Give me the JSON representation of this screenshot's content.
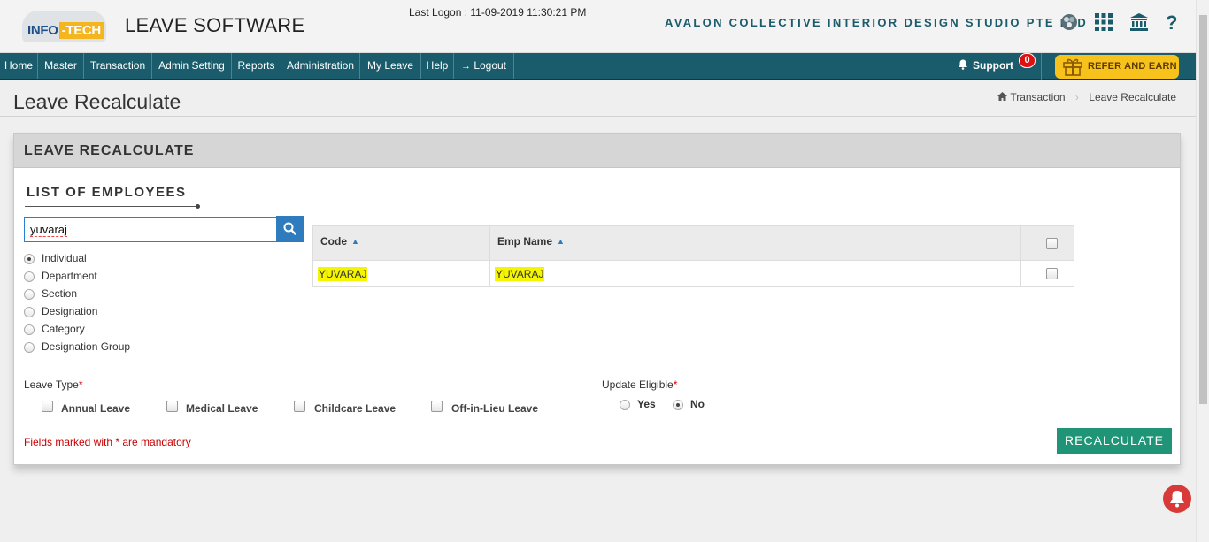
{
  "header": {
    "logo_part1": "INFO",
    "logo_part2": "-TECH",
    "app_name": "LEAVE SOFTWARE",
    "last_logon": "Last Logon : 11-09-2019 11:30:21 PM",
    "company": "AVALON COLLECTIVE INTERIOR DESIGN STUDIO PTE LTD",
    "icons": [
      "palette-icon",
      "apps-grid-icon",
      "bank-icon",
      "help-icon"
    ]
  },
  "nav": {
    "items": [
      "Home",
      "Master",
      "Transaction",
      "Admin Setting",
      "Reports",
      "Administration",
      "My Leave",
      "Help",
      "Logout"
    ],
    "support_label": "Support",
    "support_count": "0",
    "refer_label": "REFER AND EARN"
  },
  "page": {
    "title": "Leave Recalculate",
    "breadcrumb": [
      "Transaction",
      "Leave Recalculate"
    ]
  },
  "panel": {
    "heading": "LEAVE RECALCULATE",
    "employees_title": "LIST OF EMPLOYEES",
    "search_value": "yuvaraj",
    "filter_options": [
      "Individual",
      "Department",
      "Section",
      "Designation",
      "Category",
      "Designation Group"
    ],
    "selected_filter": "Individual",
    "table": {
      "columns": [
        "Code",
        "Emp Name"
      ],
      "rows": [
        {
          "code": "YUVARAJ",
          "name": "YUVARAJ"
        }
      ]
    },
    "leave_type_label": "Leave Type",
    "leave_types": [
      "Annual Leave",
      "Medical Leave",
      "Childcare Leave",
      "Off-in-Lieu Leave"
    ],
    "update_eligible_label": "Update Eligible",
    "update_options": [
      "Yes",
      "No"
    ],
    "update_selected": "No",
    "mandatory_note": "Fields marked with * are mandatory",
    "submit_label": "RECALCULATE"
  },
  "colors": {
    "nav_bg": "#1a5c6b",
    "accent_button": "#1f9476",
    "search_button": "#2e7bbd",
    "refer_bg": "#f6c21b",
    "highlight": "#f5f500"
  }
}
